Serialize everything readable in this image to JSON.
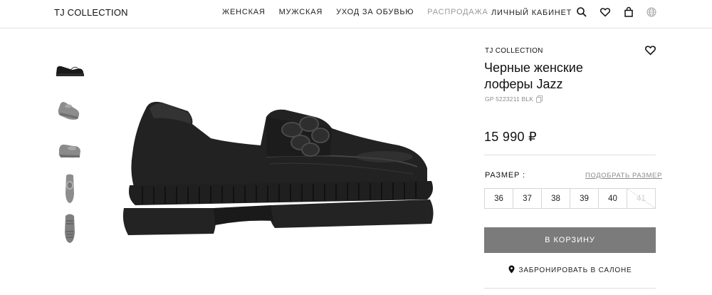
{
  "header": {
    "logo": "TJ COLLECTION",
    "nav": [
      "ЖЕНСКАЯ",
      "МУЖСКАЯ",
      "УХОД ЗА ОБУВЬЮ",
      "РАСПРОДАЖА"
    ],
    "account": "ЛИЧНЫЙ КАБИНЕТ",
    "icons": [
      "search-icon",
      "heart-icon",
      "bag-icon",
      "globe-icon"
    ]
  },
  "gallery": {
    "thumbnails": [
      "side",
      "three-quarter",
      "front-angle",
      "top",
      "sole"
    ],
    "selected_index": 0
  },
  "product": {
    "brand": "TJ COLLECTION",
    "title": "Черные женские лоферы Jazz",
    "sku": "GP 5223211 BLK",
    "price": "15 990 ₽",
    "size_label": "РАЗМЕР :",
    "size_guide": "ПОДОБРАТЬ РАЗМЕР",
    "sizes": [
      {
        "label": "36",
        "available": true
      },
      {
        "label": "37",
        "available": true
      },
      {
        "label": "38",
        "available": true
      },
      {
        "label": "39",
        "available": true
      },
      {
        "label": "40",
        "available": true
      },
      {
        "label": "41",
        "available": false
      }
    ],
    "cart_button": "В КОРЗИНУ",
    "reserve": "ЗАБРОНИРОВАТЬ В САЛОНЕ"
  },
  "colors": {
    "cart_button": "#7b7b7b",
    "sale_link": "#9a9a9a",
    "muted_text": "#8a8a8a"
  }
}
